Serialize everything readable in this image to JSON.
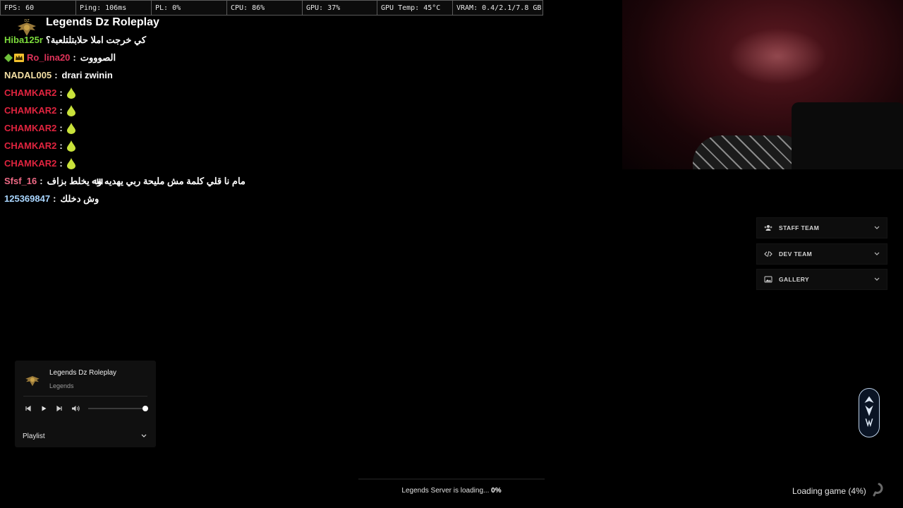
{
  "hud": {
    "fps": "FPS: 60",
    "ping": "Ping: 106ms",
    "pl": "PL: 0%",
    "cpu": "CPU: 86%",
    "gpu": "GPU: 37%",
    "gpu_temp": "GPU Temp: 45°C",
    "vram": "VRAM: 0.4/2.1/7.8 GB"
  },
  "chat": {
    "server_title": "Legends Dz Roleplay",
    "sep": ":",
    "messages": [
      {
        "name": "Hiba125r",
        "name_color": "#7ddc3c",
        "text": "كي خرجت املا حلابتلتلعبة؟"
      },
      {
        "name": "Ro_lina20",
        "name_color": "#e0335a",
        "text": "الصوووت"
      },
      {
        "name": "NADAL005",
        "name_color": "#f3dfa4",
        "text": "drari zwinin"
      },
      {
        "name": "CHAMKAR2",
        "name_color": "#e0243f",
        "icon": "drop-icon"
      },
      {
        "name": "CHAMKAR2",
        "name_color": "#e0243f",
        "icon": "drop-icon"
      },
      {
        "name": "CHAMKAR2",
        "name_color": "#e0243f",
        "icon": "drop-icon"
      },
      {
        "name": "CHAMKAR2",
        "name_color": "#e0243f",
        "icon": "drop-icon"
      },
      {
        "name": "CHAMKAR2",
        "name_color": "#e0243f",
        "icon": "drop-icon"
      },
      {
        "name": "Sfsf_16",
        "name_color": "#f06a86",
        "text": "مام نا قلي كلمة مش مليحة ربي يهديه وﷲ يخلط بزاف"
      },
      {
        "name": "125369847",
        "name_color": "#a9d6ff",
        "text": "وش دخلك"
      }
    ]
  },
  "menu": {
    "items": [
      {
        "label": "STAFF TEAM",
        "icon": "users-icon"
      },
      {
        "label": "DEV TEAM",
        "icon": "code-icon"
      },
      {
        "label": "GALLERY",
        "icon": "image-icon"
      }
    ]
  },
  "player": {
    "title": "Legends Dz Roleplay",
    "subtitle": "Legends",
    "playlist_label": "Playlist",
    "volume": 1.0
  },
  "loading": {
    "server_text": "Legends Server is loading...",
    "server_pct": "0%",
    "game_text": "Loading game (4%)"
  },
  "colors": {
    "drop": "#c9e23a",
    "green_badge": "#6fc03a",
    "crown": "#f2c12e"
  }
}
